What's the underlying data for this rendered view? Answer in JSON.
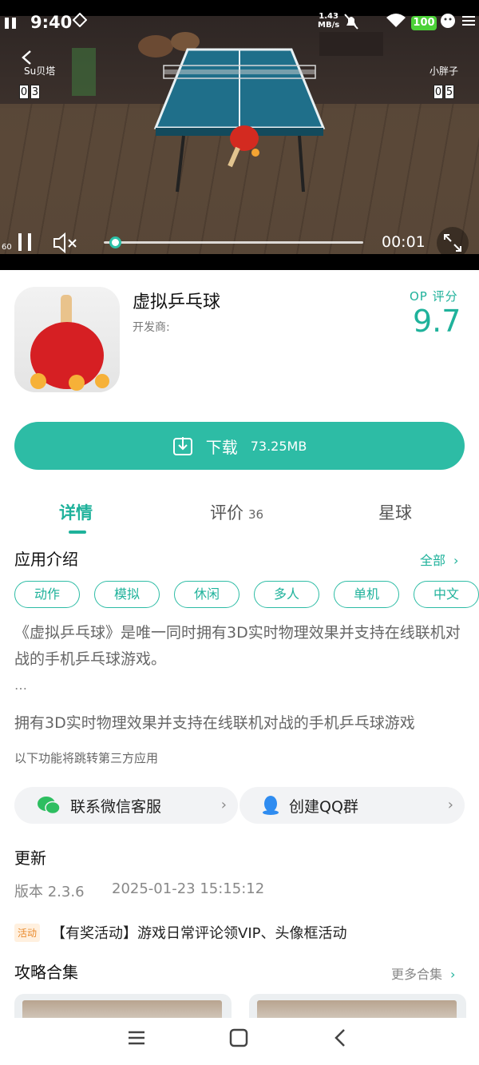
{
  "status_bar": {
    "time": "9:40",
    "net_speed_value": "1.43",
    "net_speed_unit": "MB/s",
    "battery": "100"
  },
  "video": {
    "player_left_name": "Su贝塔",
    "player_left_score": [
      "0",
      "3"
    ],
    "player_right_name": "小胖子",
    "player_right_score": [
      "0",
      "5"
    ],
    "fps": "60",
    "current_time": "00:01",
    "progress_fraction": 0.02
  },
  "app": {
    "name": "虚拟乒乓球",
    "developer_label": "开发商:",
    "rating_label": "OP 评分",
    "rating": "9.7"
  },
  "download": {
    "label": "下载",
    "size": "73.25MB"
  },
  "tabs": [
    {
      "label": "详情",
      "count": ""
    },
    {
      "label": "评价",
      "count": "36"
    },
    {
      "label": "星球",
      "count": ""
    }
  ],
  "intro": {
    "title": "应用介绍",
    "all_label": "全部",
    "tags": [
      "动作",
      "模拟",
      "休闲",
      "多人",
      "单机",
      "中文"
    ],
    "description": "《虚拟乒乓球》是唯一同时拥有3D实时物理效果并支持在线联机对战的手机乒乓球游戏。",
    "ellipsis": "…",
    "summary": "拥有3D实时物理效果并支持在线联机对战的手机乒乓球游戏",
    "third_party_note": "以下功能将跳转第三方应用"
  },
  "contact": {
    "wechat": "联系微信客服",
    "qq": "创建QQ群"
  },
  "update": {
    "title": "更新",
    "version": "版本 2.3.6",
    "date": "2025-01-23 15:15:12"
  },
  "activity": {
    "badge": "活动",
    "text": "【有奖活动】游戏日常评论领VIP、头像框活动"
  },
  "guides": {
    "title": "攻略合集",
    "more_label": "更多合集"
  },
  "colors": {
    "accent": "#2dbca5",
    "accent_text": "#1fb29b",
    "activity_badge": "#e98a2c"
  }
}
